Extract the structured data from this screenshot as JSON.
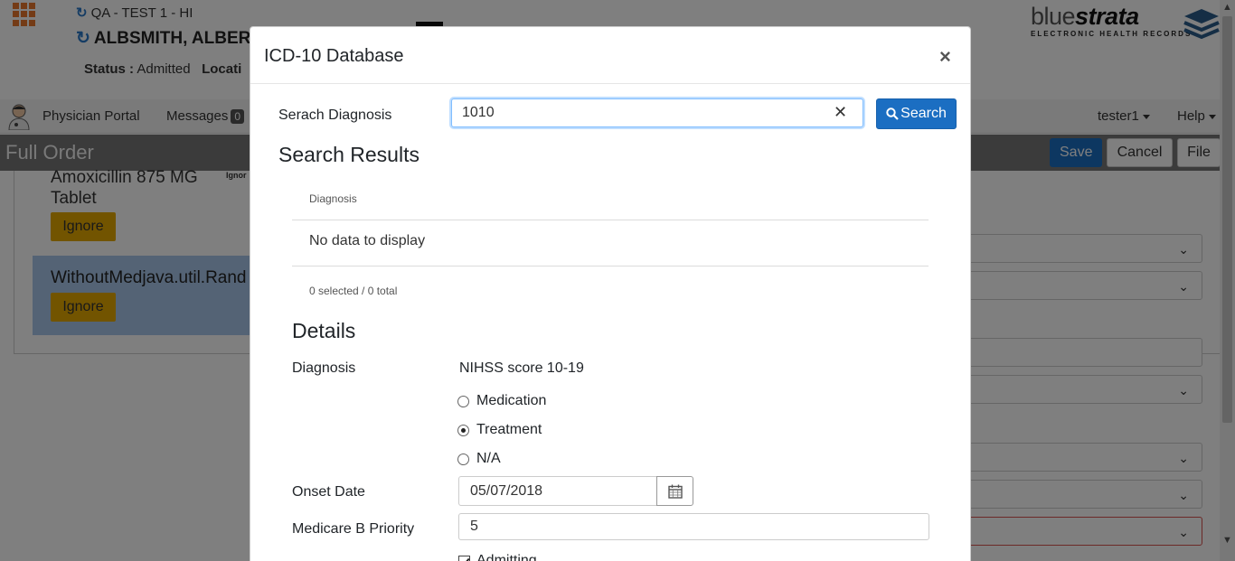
{
  "header": {
    "site": "QA - TEST 1 - HI",
    "patient_name": "ALBSMITH, ALBER",
    "status_label": "Status :",
    "status_value": "Admitted",
    "location_label": "Locati",
    "logo_blue": "blue",
    "logo_strata": "strata",
    "logo_tagline": "ELECTRONIC HEALTH RECORDS"
  },
  "navbar": {
    "physician_portal": "Physician Portal",
    "messages": "Messages",
    "messages_count": "0",
    "user": "tester1",
    "help": "Help"
  },
  "toolbar": {
    "title": "Full Order",
    "save": "Save",
    "cancel": "Cancel",
    "file": "File"
  },
  "background": {
    "drug_line1": "Amoxicillin 875 MG",
    "drug_line2": "Tablet",
    "ignore_label": "Ignor",
    "ignore_button": "Ignore",
    "selected_item": "WithoutMedjava.util.Rand",
    "selected_ignore_button": "Ignore"
  },
  "modal": {
    "title": "ICD-10 Database",
    "close": "×",
    "search_label": "Serach Diagnosis",
    "search_value": "1010",
    "clear": "✕",
    "search_button": "Search",
    "results_title": "Search Results",
    "grid_header": "Diagnosis",
    "grid_empty": "No data to display",
    "grid_footer": "0 selected / 0 total",
    "details_title": "Details",
    "diagnosis_label": "Diagnosis",
    "diagnosis_value": "NIHSS score 10-19",
    "radio_options": [
      "Medication",
      "Treatment",
      "N/A"
    ],
    "radio_selected": "Treatment",
    "onset_label": "Onset Date",
    "onset_value": "05/07/2018",
    "priority_label": "Medicare B Priority",
    "priority_value": "5",
    "admitting_label": "Admitting",
    "admitting_checked": true
  },
  "colors": {
    "primary": "#1b6ec2",
    "ignore_button": "#e5a800",
    "selected_row": "#a8c7ea",
    "toolbar": "#777777",
    "logo_accent": "#2a5d8a"
  }
}
